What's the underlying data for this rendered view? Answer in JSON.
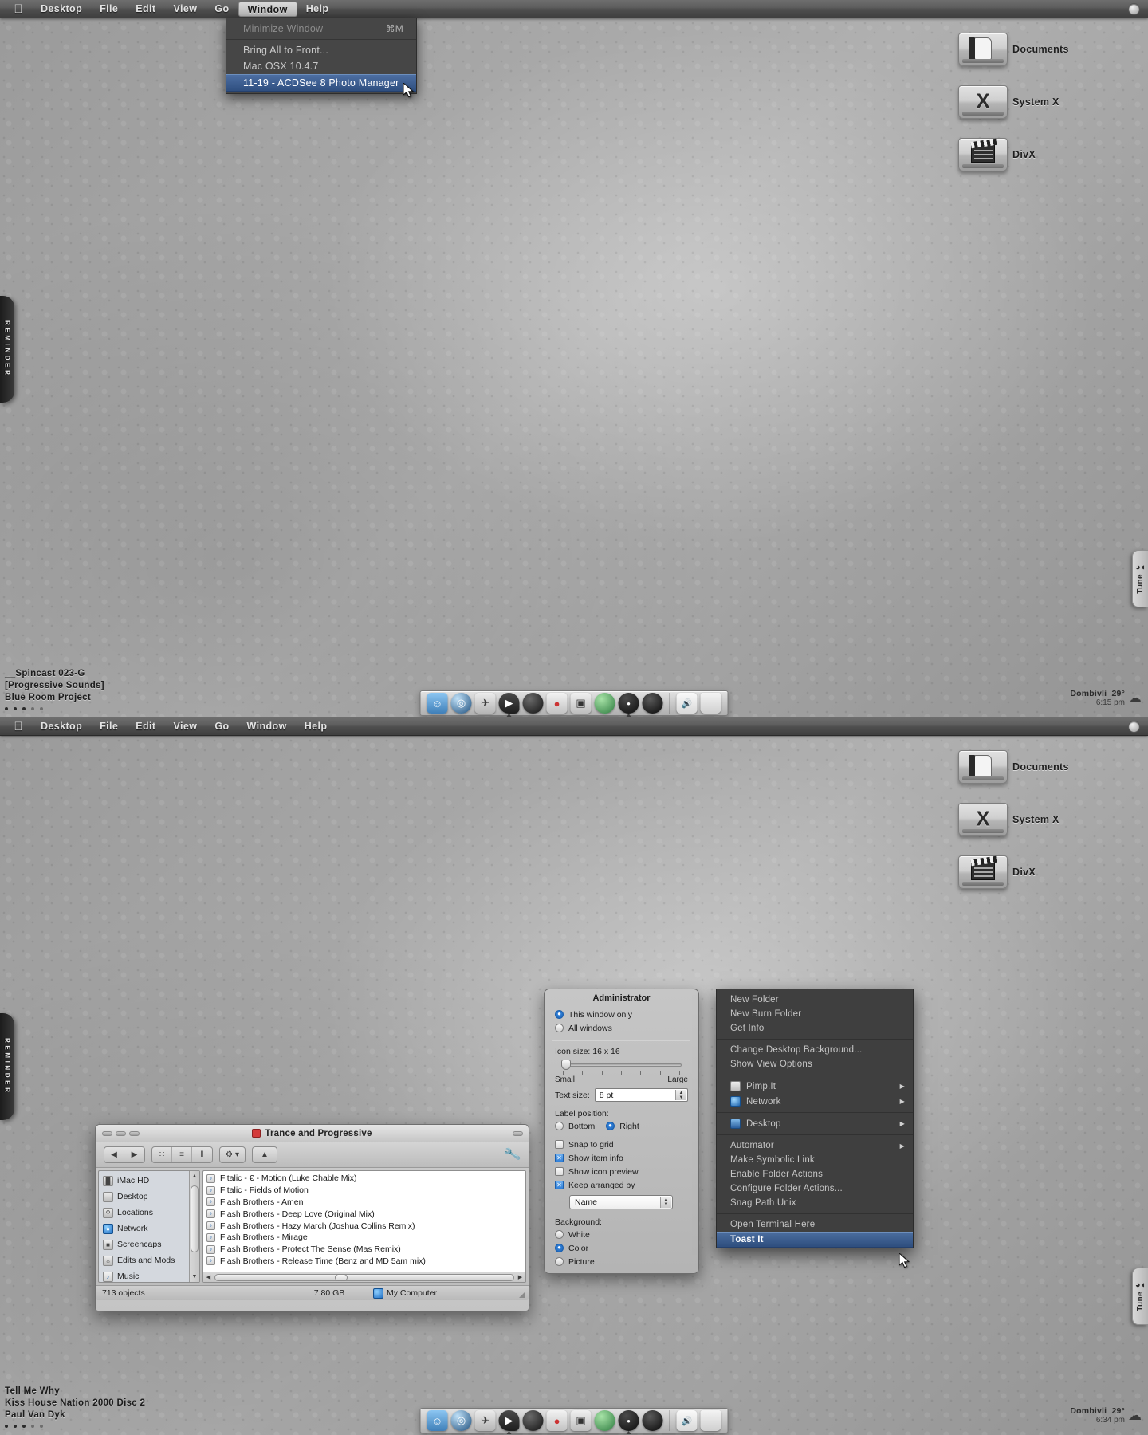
{
  "menubar": {
    "apple": "",
    "items": [
      "Desktop",
      "File",
      "Edit",
      "View",
      "Go",
      "Window",
      "Help"
    ],
    "active_item": "Window",
    "spotlight_icon": "search-icon"
  },
  "window_menu": {
    "items": [
      {
        "label": "Minimize Window",
        "shortcut": "⌘M",
        "state": "disabled"
      },
      {
        "label": "Bring All to Front...",
        "shortcut": "",
        "state": "normal"
      },
      {
        "label": "Mac OSX 10.4.7",
        "shortcut": "",
        "state": "normal"
      },
      {
        "label": "11-19 - ACDSee 8 Photo Manager",
        "shortcut": "",
        "state": "selected"
      }
    ]
  },
  "desktop_icons": [
    {
      "label": "Documents",
      "icon": "document-drive-icon"
    },
    {
      "label": "System X",
      "icon": "system-x-drive-icon"
    },
    {
      "label": "DivX",
      "icon": "divx-film-drive-icon"
    }
  ],
  "side_tabs": {
    "reminder": "REMINDER",
    "tune": "Tune",
    "tune_icon": "headphones-icon"
  },
  "now_playing_top": {
    "line1": "__Spincast 023-G",
    "line2": "[Progressive Sounds]",
    "line3": "Blue Room Project",
    "dots": 5
  },
  "now_playing_bottom": {
    "line1": "Tell Me Why",
    "line2": "Kiss House Nation 2000 Disc 2",
    "line3": "Paul Van Dyk",
    "dots": 5
  },
  "weather_top": {
    "city": "Dombivli",
    "temp": "29°",
    "time": "6:15 pm",
    "icon": "sun-cloud-icon"
  },
  "weather_bottom": {
    "city": "Dombivli",
    "temp": "29°",
    "time": "6:34 pm",
    "icon": "sun-cloud-icon"
  },
  "dock": {
    "items": [
      {
        "name": "finder-icon",
        "color": "#5fa8e0",
        "glyph": "☺",
        "running": false
      },
      {
        "name": "safari-icon",
        "color": "#2e6fa8",
        "glyph": "◎",
        "running": false
      },
      {
        "name": "rocket-icon",
        "color": "#d8d8d8",
        "glyph": "✈",
        "running": false
      },
      {
        "name": "ichat-icon",
        "color": "#2b2b2b",
        "glyph": "▶",
        "running": true
      },
      {
        "name": "sphere-icon",
        "color": "#232323",
        "glyph": "•",
        "running": false
      },
      {
        "name": "robot-icon",
        "color": "#e4e4e4",
        "glyph": "⚙",
        "running": false
      },
      {
        "name": "iphoto-icon",
        "color": "#cfcfcf",
        "glyph": "▣",
        "running": false
      },
      {
        "name": "globe-icon",
        "color": "#4fa14f",
        "glyph": "●",
        "running": false
      },
      {
        "name": "disc-icon",
        "color": "#1c1c1c",
        "glyph": "●",
        "running": true
      },
      {
        "name": "camera-lens-icon",
        "color": "#161616",
        "glyph": "◉",
        "running": false
      }
    ],
    "tray": [
      {
        "name": "speaker-icon",
        "glyph": "🔊"
      },
      {
        "name": "trash-icon",
        "glyph": "☐"
      }
    ]
  },
  "finder": {
    "title": "Trance and Progressive",
    "title_icon": "folder-icon",
    "toolbar": {
      "back": "◀",
      "forward": "▶",
      "view_icon": "∷",
      "view_list": "≡",
      "view_column": "‖",
      "action": "⚙",
      "action_caret": "▾",
      "eject": "▲",
      "tools_icon": "tools-icon"
    },
    "sidebar": [
      {
        "label": "iMac HD",
        "icon": "harddisk-icon"
      },
      {
        "label": "Desktop",
        "icon": "desktop-icon"
      },
      {
        "label": "Locations",
        "icon": "locations-icon"
      },
      {
        "label": "Network",
        "icon": "network-globe-icon"
      },
      {
        "label": "Screencaps",
        "icon": "screencaps-icon"
      },
      {
        "label": "Edits and Mods",
        "icon": "edits-icon"
      },
      {
        "label": "Music",
        "icon": "music-icon"
      }
    ],
    "files": [
      "Fitalic - € - Motion (Luke Chable Mix)",
      "Fitalic - Fields of Motion",
      "Flash Brothers - Amen",
      "Flash Brothers - Deep Love (Original Mix)",
      "Flash Brothers - Hazy March (Joshua Collins Remix)",
      "Flash Brothers - Mirage",
      "Flash Brothers - Protect The Sense (Mas Remix)",
      "Flash Brothers - Release Time (Benz and MD 5am mix)"
    ],
    "status": {
      "objects": "713 objects",
      "size": "7.80 GB",
      "location": "My Computer",
      "location_icon": "computer-icon"
    }
  },
  "view_options": {
    "title": "Administrator",
    "scope": [
      {
        "label": "This window only",
        "selected": true
      },
      {
        "label": "All windows",
        "selected": false
      }
    ],
    "icon_size_label": "Icon size: 16 x 16",
    "slider_min_label": "Small",
    "slider_max_label": "Large",
    "slider_value": 0,
    "text_size_label": "Text size:",
    "text_size_value": "8 pt",
    "label_position_label": "Label position:",
    "label_position": [
      {
        "label": "Bottom",
        "selected": false
      },
      {
        "label": "Right",
        "selected": true
      }
    ],
    "checkboxes": [
      {
        "label": "Snap to grid",
        "checked": false
      },
      {
        "label": "Show item info",
        "checked": true
      },
      {
        "label": "Show icon preview",
        "checked": false
      },
      {
        "label": "Keep arranged by",
        "checked": true
      }
    ],
    "arrange_value": "Name",
    "background_label": "Background:",
    "background": [
      {
        "label": "White",
        "selected": false
      },
      {
        "label": "Color",
        "selected": true
      },
      {
        "label": "Picture",
        "selected": false
      }
    ]
  },
  "context_menu": {
    "groups": [
      [
        {
          "label": "New Folder",
          "icon": null,
          "submenu": false,
          "selected": false
        },
        {
          "label": "New Burn Folder",
          "icon": null,
          "submenu": false,
          "selected": false
        },
        {
          "label": "Get Info",
          "icon": null,
          "submenu": false,
          "selected": false
        }
      ],
      [
        {
          "label": "Change Desktop Background...",
          "icon": null,
          "submenu": false,
          "selected": false
        },
        {
          "label": "Show View Options",
          "icon": null,
          "submenu": false,
          "selected": false
        }
      ],
      [
        {
          "label": "Pimp.It",
          "icon": "disk-icon",
          "submenu": true,
          "selected": false
        },
        {
          "label": "Network",
          "icon": "network-globe-icon",
          "submenu": true,
          "selected": false
        }
      ],
      [
        {
          "label": "Desktop",
          "icon": "desktop-icon",
          "submenu": true,
          "selected": false
        }
      ],
      [
        {
          "label": "Automator",
          "icon": null,
          "submenu": true,
          "selected": false
        },
        {
          "label": "Make Symbolic Link",
          "icon": null,
          "submenu": false,
          "selected": false
        },
        {
          "label": "Enable Folder Actions",
          "icon": null,
          "submenu": false,
          "selected": false
        },
        {
          "label": "Configure Folder Actions...",
          "icon": null,
          "submenu": false,
          "selected": false
        },
        {
          "label": "Snag Path Unix",
          "icon": null,
          "submenu": false,
          "selected": false
        }
      ],
      [
        {
          "label": "Open Terminal Here",
          "icon": null,
          "submenu": false,
          "selected": false
        },
        {
          "label": "Toast It",
          "icon": null,
          "submenu": false,
          "selected": true
        }
      ]
    ]
  }
}
